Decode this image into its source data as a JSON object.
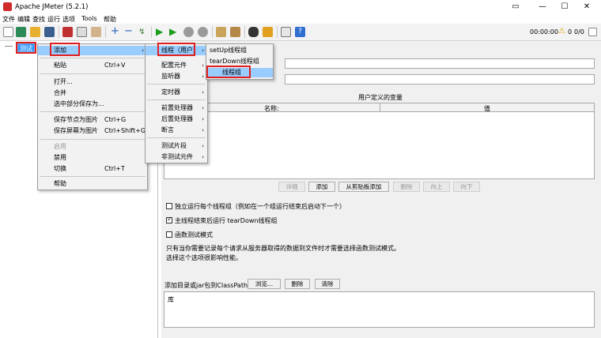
{
  "window": {
    "title": "Apache JMeter (5.2.1)"
  },
  "menubar": [
    "文件",
    "编辑",
    "查找",
    "运行",
    "选项",
    "Tools",
    "帮助"
  ],
  "toolbar": {
    "timer": "00:00:00",
    "warn_count": "0",
    "threads": "0/0"
  },
  "tree": {
    "selected_node": "测试"
  },
  "context_menu": {
    "items": [
      {
        "label": "添加",
        "shortcut": "",
        "submenu": true,
        "highlight": true
      },
      {
        "label": "粘贴",
        "shortcut": "Ctrl+V"
      },
      {
        "label": "打开..."
      },
      {
        "label": "合并"
      },
      {
        "label": "选中部分保存为..."
      },
      {
        "label": "保存节点为图片",
        "shortcut": "Ctrl+G"
      },
      {
        "label": "保存屏幕为图片",
        "shortcut": "Ctrl+Shift+G"
      },
      {
        "label": "启用",
        "disabled": true
      },
      {
        "label": "禁用"
      },
      {
        "label": "切换",
        "shortcut": "Ctrl+T"
      },
      {
        "label": "帮助"
      }
    ]
  },
  "add_menu": {
    "items": [
      "线程（用户）",
      "配置元件",
      "监听器",
      "定时器",
      "前置处理器",
      "后置处理器",
      "断言",
      "测试片段",
      "非测试元件"
    ]
  },
  "thread_menu": {
    "items": [
      "setUp线程组",
      "tearDown线程组",
      "线程组"
    ]
  },
  "udv": {
    "title": "用户定义的变量",
    "col_name": "名称:",
    "col_value": "值"
  },
  "udv_buttons": [
    {
      "label": "详细",
      "disabled": true
    },
    {
      "label": "添加",
      "disabled": false
    },
    {
      "label": "从剪贴板添加",
      "disabled": false
    },
    {
      "label": "删除",
      "disabled": true
    },
    {
      "label": "向上",
      "disabled": true
    },
    {
      "label": "向下",
      "disabled": true
    }
  ],
  "options": {
    "run_each": "独立运行每个线程组（例如在一个组运行结束后启动下一个）",
    "run_teardown": "主线程结束后运行 tearDown线程组",
    "functional": "函数测试模式"
  },
  "note": {
    "line1": "只有当你需要记录每个请求从服务器取得的数据到文件时才需要选择函数测试模式。",
    "line2": "选择这个选项很影响性能。"
  },
  "classpath": {
    "label": "添加目录或jar包到ClassPath",
    "browse": "浏览...",
    "delete": "删除",
    "clear": "清除",
    "lib_label": "库"
  },
  "colors": {
    "highlight": "#99ccff",
    "selection": "#3399ff",
    "annotation": "#e02020"
  }
}
